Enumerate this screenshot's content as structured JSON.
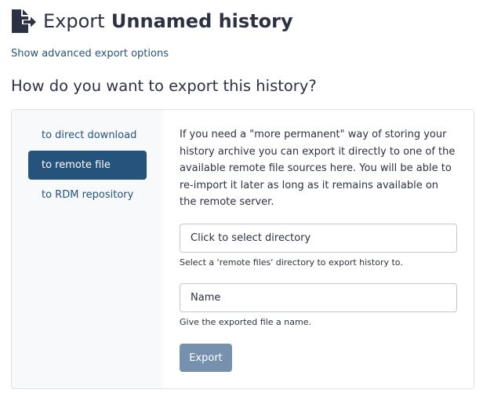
{
  "header": {
    "title_prefix": "Export",
    "history_name": "Unnamed history",
    "icon": "file-export-icon"
  },
  "advanced_link": "Show advanced export options",
  "question": "How do you want to export this history?",
  "nav": {
    "items": [
      {
        "label": "to direct download",
        "active": false
      },
      {
        "label": "to remote file",
        "active": true
      },
      {
        "label": "to RDM repository",
        "active": false
      }
    ]
  },
  "remote_file": {
    "description": "If you need a \"more permanent\" way of storing your history archive you can export it directly to one of the available remote file sources here. You will be able to re-import it later as long as it remains available on the remote server.",
    "directory": {
      "placeholder": "Click to select directory",
      "help": "Select a 'remote files' directory to export history to."
    },
    "name": {
      "placeholder": "Name",
      "help": "Give the exported file a name."
    },
    "export_button": "Export"
  },
  "colors": {
    "primary": "#25537b",
    "disabled_button": "#7691ad",
    "text": "#2c3143",
    "nav_background": "#f8f9fa"
  }
}
